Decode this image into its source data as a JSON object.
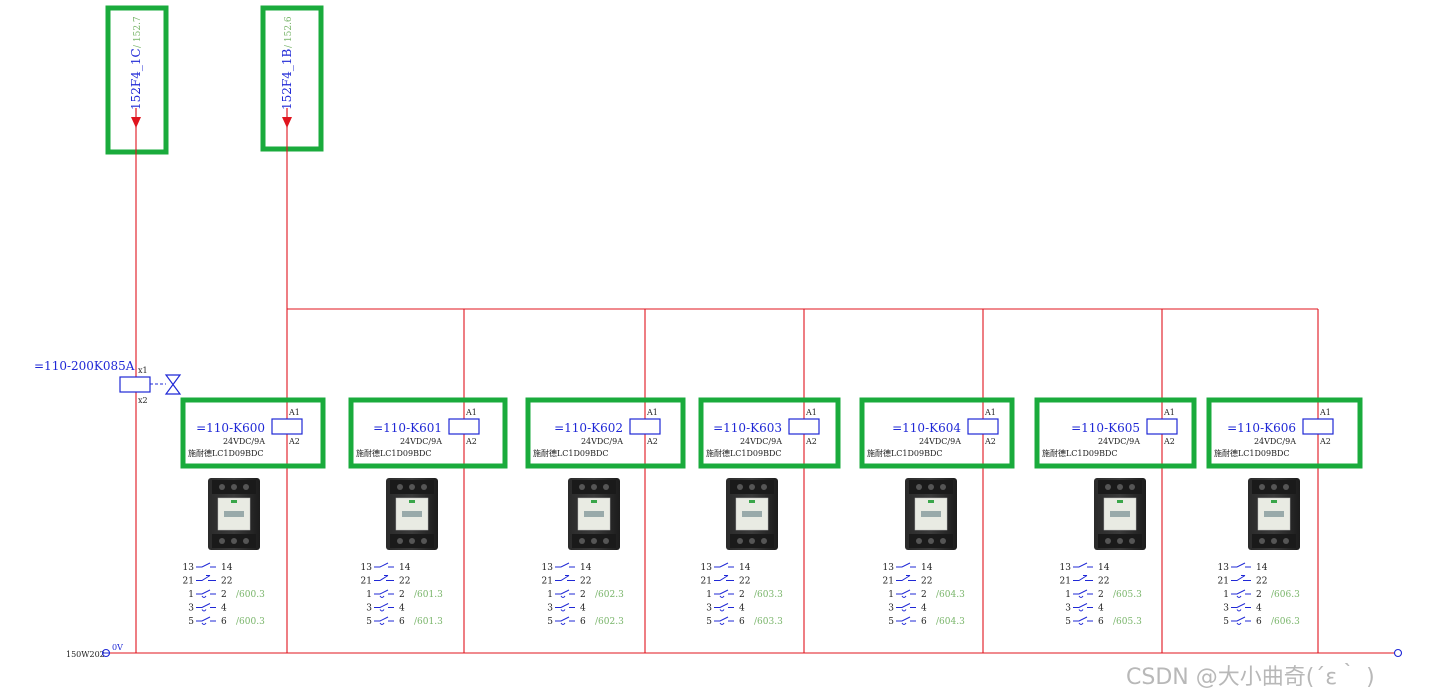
{
  "colors": {
    "wire": "#e0141e",
    "symbol": "#1f28d6",
    "highlight": "#1aab3c",
    "ref": "#79b56a",
    "text": "#222222",
    "watermark": "#b8b8b8"
  },
  "sources": [
    {
      "label": "152F4_1C",
      "ref": "/ 152.7"
    },
    {
      "label": "152F4_1B",
      "ref": "/ 152.6"
    }
  ],
  "diode": {
    "label": "=110-200K085A",
    "pin_top": "x1",
    "pin_bottom": "x2"
  },
  "relays": [
    {
      "tag": "=110-K600",
      "rating": "24VDC/9A",
      "model": "施耐德LC1D09BDC",
      "pin_a1": "A1",
      "pin_a2": "A2",
      "contacts": [
        {
          "l": "13",
          "r": "14",
          "ref": ""
        },
        {
          "l": "21",
          "r": "22",
          "ref": ""
        },
        {
          "l": "1",
          "r": "2",
          "ref": "/600.3"
        },
        {
          "l": "3",
          "r": "4",
          "ref": ""
        },
        {
          "l": "5",
          "r": "6",
          "ref": "/600.3"
        }
      ]
    },
    {
      "tag": "=110-K601",
      "rating": "24VDC/9A",
      "model": "施耐德LC1D09BDC",
      "pin_a1": "A1",
      "pin_a2": "A2",
      "contacts": [
        {
          "l": "13",
          "r": "14",
          "ref": ""
        },
        {
          "l": "21",
          "r": "22",
          "ref": ""
        },
        {
          "l": "1",
          "r": "2",
          "ref": "/601.3"
        },
        {
          "l": "3",
          "r": "4",
          "ref": ""
        },
        {
          "l": "5",
          "r": "6",
          "ref": "/601.3"
        }
      ]
    },
    {
      "tag": "=110-K602",
      "rating": "24VDC/9A",
      "model": "施耐德LC1D09BDC",
      "pin_a1": "A1",
      "pin_a2": "A2",
      "contacts": [
        {
          "l": "13",
          "r": "14",
          "ref": ""
        },
        {
          "l": "21",
          "r": "22",
          "ref": ""
        },
        {
          "l": "1",
          "r": "2",
          "ref": "/602.3"
        },
        {
          "l": "3",
          "r": "4",
          "ref": ""
        },
        {
          "l": "5",
          "r": "6",
          "ref": "/602.3"
        }
      ]
    },
    {
      "tag": "=110-K603",
      "rating": "24VDC/9A",
      "model": "施耐德LC1D09BDC",
      "pin_a1": "A1",
      "pin_a2": "A2",
      "contacts": [
        {
          "l": "13",
          "r": "14",
          "ref": ""
        },
        {
          "l": "21",
          "r": "22",
          "ref": ""
        },
        {
          "l": "1",
          "r": "2",
          "ref": "/603.3"
        },
        {
          "l": "3",
          "r": "4",
          "ref": ""
        },
        {
          "l": "5",
          "r": "6",
          "ref": "/603.3"
        }
      ]
    },
    {
      "tag": "=110-K604",
      "rating": "24VDC/9A",
      "model": "施耐德LC1D09BDC",
      "pin_a1": "A1",
      "pin_a2": "A2",
      "contacts": [
        {
          "l": "13",
          "r": "14",
          "ref": ""
        },
        {
          "l": "21",
          "r": "22",
          "ref": ""
        },
        {
          "l": "1",
          "r": "2",
          "ref": "/604.3"
        },
        {
          "l": "3",
          "r": "4",
          "ref": ""
        },
        {
          "l": "5",
          "r": "6",
          "ref": "/604.3"
        }
      ]
    },
    {
      "tag": "=110-K605",
      "rating": "24VDC/9A",
      "model": "施耐德LC1D09BDC",
      "pin_a1": "A1",
      "pin_a2": "A2",
      "contacts": [
        {
          "l": "13",
          "r": "14",
          "ref": ""
        },
        {
          "l": "21",
          "r": "22",
          "ref": ""
        },
        {
          "l": "1",
          "r": "2",
          "ref": "/605.3"
        },
        {
          "l": "3",
          "r": "4",
          "ref": ""
        },
        {
          "l": "5",
          "r": "6",
          "ref": "/605.3"
        }
      ]
    },
    {
      "tag": "=110-K606",
      "rating": "24VDC/9A",
      "model": "施耐德LC1D09BDC",
      "pin_a1": "A1",
      "pin_a2": "A2",
      "contacts": [
        {
          "l": "13",
          "r": "14",
          "ref": ""
        },
        {
          "l": "21",
          "r": "22",
          "ref": ""
        },
        {
          "l": "1",
          "r": "2",
          "ref": "/606.3"
        },
        {
          "l": "3",
          "r": "4",
          "ref": ""
        },
        {
          "l": "5",
          "r": "6",
          "ref": "/606.3"
        }
      ]
    }
  ],
  "bus": {
    "left_label": "150W202",
    "zero_label": "0V"
  },
  "watermark": "CSDN @大小曲奇(´ε｀ )"
}
